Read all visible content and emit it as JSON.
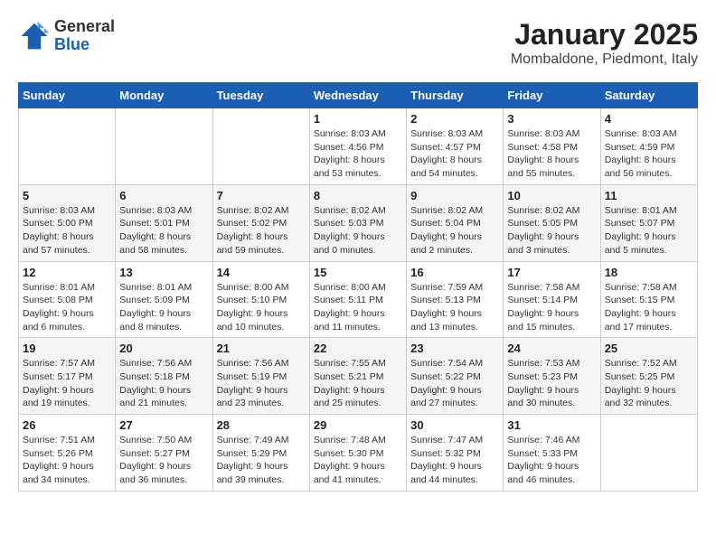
{
  "header": {
    "logo_general": "General",
    "logo_blue": "Blue",
    "month_title": "January 2025",
    "location": "Mombaldone, Piedmont, Italy"
  },
  "weekdays": [
    "Sunday",
    "Monday",
    "Tuesday",
    "Wednesday",
    "Thursday",
    "Friday",
    "Saturday"
  ],
  "weeks": [
    [
      {
        "day": "",
        "info": ""
      },
      {
        "day": "",
        "info": ""
      },
      {
        "day": "",
        "info": ""
      },
      {
        "day": "1",
        "info": "Sunrise: 8:03 AM\nSunset: 4:56 PM\nDaylight: 8 hours\nand 53 minutes."
      },
      {
        "day": "2",
        "info": "Sunrise: 8:03 AM\nSunset: 4:57 PM\nDaylight: 8 hours\nand 54 minutes."
      },
      {
        "day": "3",
        "info": "Sunrise: 8:03 AM\nSunset: 4:58 PM\nDaylight: 8 hours\nand 55 minutes."
      },
      {
        "day": "4",
        "info": "Sunrise: 8:03 AM\nSunset: 4:59 PM\nDaylight: 8 hours\nand 56 minutes."
      }
    ],
    [
      {
        "day": "5",
        "info": "Sunrise: 8:03 AM\nSunset: 5:00 PM\nDaylight: 8 hours\nand 57 minutes."
      },
      {
        "day": "6",
        "info": "Sunrise: 8:03 AM\nSunset: 5:01 PM\nDaylight: 8 hours\nand 58 minutes."
      },
      {
        "day": "7",
        "info": "Sunrise: 8:02 AM\nSunset: 5:02 PM\nDaylight: 8 hours\nand 59 minutes."
      },
      {
        "day": "8",
        "info": "Sunrise: 8:02 AM\nSunset: 5:03 PM\nDaylight: 9 hours\nand 0 minutes."
      },
      {
        "day": "9",
        "info": "Sunrise: 8:02 AM\nSunset: 5:04 PM\nDaylight: 9 hours\nand 2 minutes."
      },
      {
        "day": "10",
        "info": "Sunrise: 8:02 AM\nSunset: 5:05 PM\nDaylight: 9 hours\nand 3 minutes."
      },
      {
        "day": "11",
        "info": "Sunrise: 8:01 AM\nSunset: 5:07 PM\nDaylight: 9 hours\nand 5 minutes."
      }
    ],
    [
      {
        "day": "12",
        "info": "Sunrise: 8:01 AM\nSunset: 5:08 PM\nDaylight: 9 hours\nand 6 minutes."
      },
      {
        "day": "13",
        "info": "Sunrise: 8:01 AM\nSunset: 5:09 PM\nDaylight: 9 hours\nand 8 minutes."
      },
      {
        "day": "14",
        "info": "Sunrise: 8:00 AM\nSunset: 5:10 PM\nDaylight: 9 hours\nand 10 minutes."
      },
      {
        "day": "15",
        "info": "Sunrise: 8:00 AM\nSunset: 5:11 PM\nDaylight: 9 hours\nand 11 minutes."
      },
      {
        "day": "16",
        "info": "Sunrise: 7:59 AM\nSunset: 5:13 PM\nDaylight: 9 hours\nand 13 minutes."
      },
      {
        "day": "17",
        "info": "Sunrise: 7:58 AM\nSunset: 5:14 PM\nDaylight: 9 hours\nand 15 minutes."
      },
      {
        "day": "18",
        "info": "Sunrise: 7:58 AM\nSunset: 5:15 PM\nDaylight: 9 hours\nand 17 minutes."
      }
    ],
    [
      {
        "day": "19",
        "info": "Sunrise: 7:57 AM\nSunset: 5:17 PM\nDaylight: 9 hours\nand 19 minutes."
      },
      {
        "day": "20",
        "info": "Sunrise: 7:56 AM\nSunset: 5:18 PM\nDaylight: 9 hours\nand 21 minutes."
      },
      {
        "day": "21",
        "info": "Sunrise: 7:56 AM\nSunset: 5:19 PM\nDaylight: 9 hours\nand 23 minutes."
      },
      {
        "day": "22",
        "info": "Sunrise: 7:55 AM\nSunset: 5:21 PM\nDaylight: 9 hours\nand 25 minutes."
      },
      {
        "day": "23",
        "info": "Sunrise: 7:54 AM\nSunset: 5:22 PM\nDaylight: 9 hours\nand 27 minutes."
      },
      {
        "day": "24",
        "info": "Sunrise: 7:53 AM\nSunset: 5:23 PM\nDaylight: 9 hours\nand 30 minutes."
      },
      {
        "day": "25",
        "info": "Sunrise: 7:52 AM\nSunset: 5:25 PM\nDaylight: 9 hours\nand 32 minutes."
      }
    ],
    [
      {
        "day": "26",
        "info": "Sunrise: 7:51 AM\nSunset: 5:26 PM\nDaylight: 9 hours\nand 34 minutes."
      },
      {
        "day": "27",
        "info": "Sunrise: 7:50 AM\nSunset: 5:27 PM\nDaylight: 9 hours\nand 36 minutes."
      },
      {
        "day": "28",
        "info": "Sunrise: 7:49 AM\nSunset: 5:29 PM\nDaylight: 9 hours\nand 39 minutes."
      },
      {
        "day": "29",
        "info": "Sunrise: 7:48 AM\nSunset: 5:30 PM\nDaylight: 9 hours\nand 41 minutes."
      },
      {
        "day": "30",
        "info": "Sunrise: 7:47 AM\nSunset: 5:32 PM\nDaylight: 9 hours\nand 44 minutes."
      },
      {
        "day": "31",
        "info": "Sunrise: 7:46 AM\nSunset: 5:33 PM\nDaylight: 9 hours\nand 46 minutes."
      },
      {
        "day": "",
        "info": ""
      }
    ]
  ]
}
